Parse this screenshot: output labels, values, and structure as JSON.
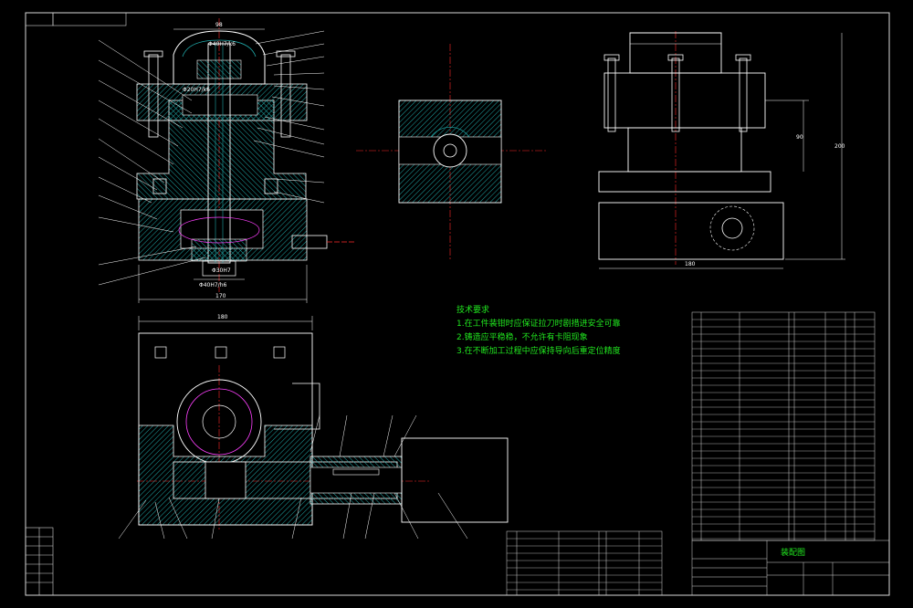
{
  "tech_requirements": {
    "heading": "技术要求",
    "items": [
      "1.在工件装钳时应保证拉刀时剧措进安全可靠",
      "2.铸造应平稳稳，不允许有卡阻现象",
      "3.在不断加工过程中应保持导向后重定位精度"
    ]
  },
  "title_block": {
    "drawing_name": "装配图"
  },
  "dimensions": {
    "top_width": "98",
    "fit_upper": "Φ40H7/k6",
    "fit_mid": "Φ30H7",
    "fit_bottom": "Φ40H7/h6",
    "fit_small": "Φ20H7/k6",
    "base_width": "170",
    "plan_width": "180",
    "side_width": "180",
    "side_height_inner": "90",
    "side_height_total": "200"
  },
  "colors": {
    "outline": "#ffffff",
    "hatch": "#1fa6a6",
    "centerline": "#ff2a2a",
    "text": "#21e81f",
    "accent": "#ff40ff",
    "frame": "#d8d8d8"
  }
}
